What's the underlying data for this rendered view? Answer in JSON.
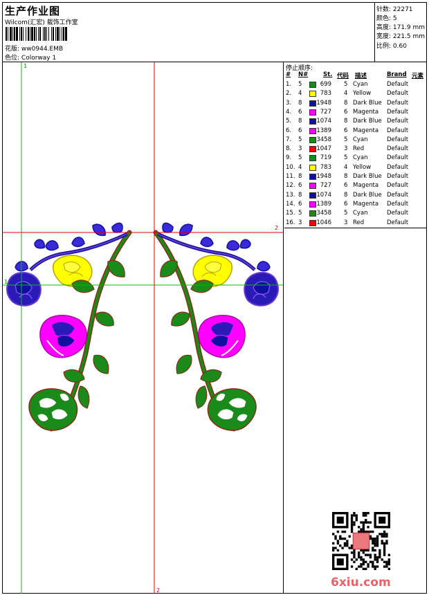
{
  "header": {
    "title": "生产作业图",
    "company": "Wilcom(汇宏) 载饰工作室",
    "design_label": "花版:",
    "design_value": "ww0944.EMB",
    "colorway_label": "色位:",
    "colorway_value": "Colorway 1"
  },
  "info": {
    "stitches": "针数: 22271",
    "colors": "颜色: 5",
    "height": "高度: 171.9 mm",
    "width": "宽度: 221.5 mm",
    "scale": "比例: 0.60"
  },
  "guides": {
    "v1": "1",
    "v2": "2",
    "h1": "1",
    "h2": "2"
  },
  "sequence": {
    "title": "停止顺序:",
    "headers": {
      "num": "#",
      "needle": "N#",
      "st": "St.",
      "code": "代码",
      "desc": "描述",
      "brand": "Brand",
      "element": "元素"
    },
    "rows": [
      {
        "num": "1.",
        "needle": "5",
        "color": "#1a8a1a",
        "st": "699",
        "code": "5",
        "desc": "Cyan",
        "brand": "Default"
      },
      {
        "num": "2.",
        "needle": "4",
        "color": "#ffff00",
        "st": "783",
        "code": "4",
        "desc": "Yellow",
        "brand": "Default"
      },
      {
        "num": "3.",
        "needle": "8",
        "color": "#1010a0",
        "st": "1948",
        "code": "8",
        "desc": "Dark Blue",
        "brand": "Default"
      },
      {
        "num": "4.",
        "needle": "6",
        "color": "#ff00ff",
        "st": "727",
        "code": "6",
        "desc": "Magenta",
        "brand": "Default"
      },
      {
        "num": "5.",
        "needle": "8",
        "color": "#1010a0",
        "st": "1074",
        "code": "8",
        "desc": "Dark Blue",
        "brand": "Default"
      },
      {
        "num": "6.",
        "needle": "6",
        "color": "#ff00ff",
        "st": "1389",
        "code": "6",
        "desc": "Magenta",
        "brand": "Default"
      },
      {
        "num": "7.",
        "needle": "5",
        "color": "#1a8a1a",
        "st": "3458",
        "code": "5",
        "desc": "Cyan",
        "brand": "Default"
      },
      {
        "num": "8.",
        "needle": "3",
        "color": "#ff0000",
        "st": "1047",
        "code": "3",
        "desc": "Red",
        "brand": "Default"
      },
      {
        "num": "9.",
        "needle": "5",
        "color": "#1a8a1a",
        "st": "719",
        "code": "5",
        "desc": "Cyan",
        "brand": "Default"
      },
      {
        "num": "10.",
        "needle": "4",
        "color": "#ffff00",
        "st": "783",
        "code": "4",
        "desc": "Yellow",
        "brand": "Default"
      },
      {
        "num": "11.",
        "needle": "8",
        "color": "#1010a0",
        "st": "1948",
        "code": "8",
        "desc": "Dark Blue",
        "brand": "Default"
      },
      {
        "num": "12.",
        "needle": "6",
        "color": "#ff00ff",
        "st": "727",
        "code": "6",
        "desc": "Magenta",
        "brand": "Default"
      },
      {
        "num": "13.",
        "needle": "8",
        "color": "#1010a0",
        "st": "1074",
        "code": "8",
        "desc": "Dark Blue",
        "brand": "Default"
      },
      {
        "num": "14.",
        "needle": "6",
        "color": "#ff00ff",
        "st": "1389",
        "code": "6",
        "desc": "Magenta",
        "brand": "Default"
      },
      {
        "num": "15.",
        "needle": "5",
        "color": "#1a8a1a",
        "st": "3458",
        "code": "5",
        "desc": "Cyan",
        "brand": "Default"
      },
      {
        "num": "16.",
        "needle": "3",
        "color": "#ff0000",
        "st": "1046",
        "code": "3",
        "desc": "Red",
        "brand": "Default"
      }
    ]
  },
  "watermark": {
    "site": "6xiu.com"
  }
}
